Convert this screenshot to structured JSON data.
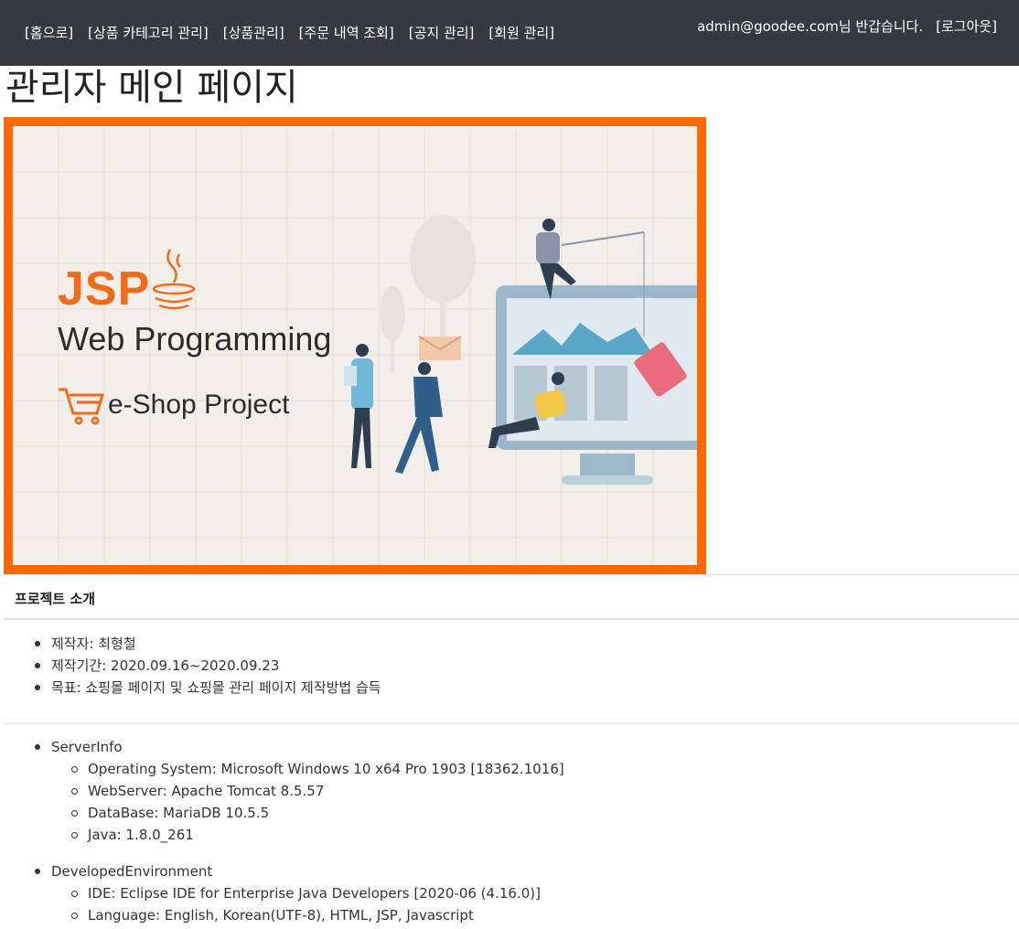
{
  "nav": {
    "links": [
      "[홈으로]",
      "[상품 카테고리 관리]",
      "[상품관리]",
      "[주문 내역 조회]",
      "[공지 관리]",
      "[회원 관리]"
    ],
    "greeting": "admin@goodee.com님 반갑습니다.",
    "logout": "[로그아웃]"
  },
  "page_title": "관리자 메인 페이지",
  "banner": {
    "line1": "JSP",
    "line2": "Web Programming",
    "line3": "e-Shop Project",
    "border_color": "#ff6a00",
    "accent_color": "#f26b1a"
  },
  "intro": {
    "heading": "프로젝트 소개",
    "items": [
      "제작자: 최형철",
      "제작기간: 2020.09.16~2020.09.23",
      "목표: 쇼핑몰 페이지 및 쇼핑몰 관리 페이지 제작방법 습득"
    ]
  },
  "server": {
    "title": "ServerInfo",
    "items": [
      "Operating System: Microsoft Windows 10 x64 Pro 1903 [18362.1016]",
      "WebServer: Apache Tomcat 8.5.57",
      "DataBase: MariaDB 10.5.5",
      "Java: 1.8.0_261"
    ]
  },
  "dev": {
    "title": "DevelopedEnvironment",
    "items": [
      "IDE: Eclipse IDE for Enterprise Java Developers [2020-06 (4.16.0)]",
      "Language: English, Korean(UTF-8), HTML, JSP, Javascript"
    ]
  }
}
